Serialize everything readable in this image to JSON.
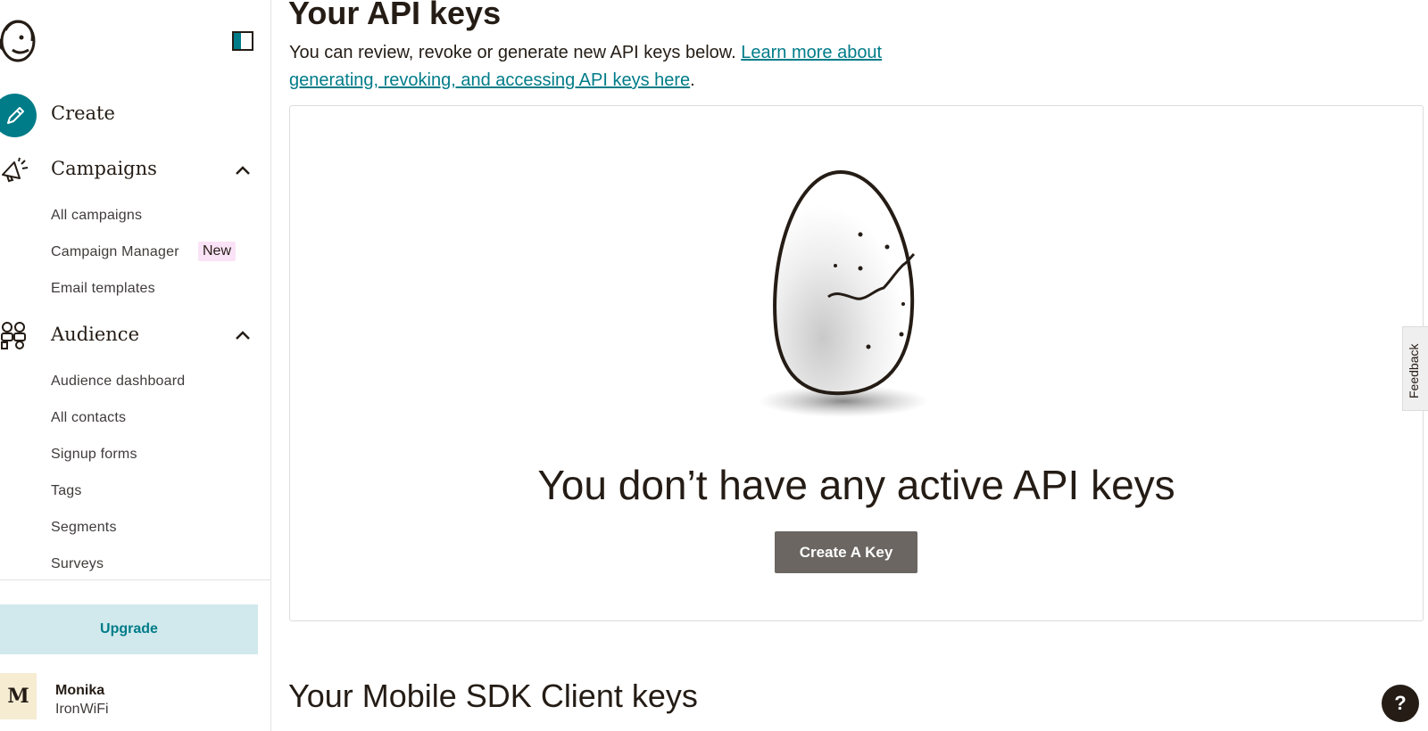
{
  "sidebar": {
    "create_label": "Create",
    "campaigns": {
      "label": "Campaigns",
      "items": [
        "All campaigns",
        "Campaign Manager",
        "Email templates"
      ],
      "new_badge": "New"
    },
    "audience": {
      "label": "Audience",
      "items": [
        "Audience dashboard",
        "All contacts",
        "Signup forms",
        "Tags",
        "Segments",
        "Surveys"
      ]
    },
    "upgrade_label": "Upgrade",
    "user": {
      "initial": "M",
      "name": "Monika",
      "org": "IronWiFi"
    }
  },
  "main": {
    "page_title": "Your API keys",
    "intro_text": "You can review, revoke or generate new API keys below. ",
    "intro_link": "Learn more about generating, revoking, and accessing API keys here",
    "intro_period": ".",
    "empty_state_heading": "You don’t have any active API keys",
    "create_key_label": "Create A Key",
    "mobile_section_title": "Your Mobile SDK Client keys"
  },
  "feedback_label": "Feedback",
  "help_label": "?",
  "colors": {
    "accent": "#007c89",
    "upgrade_bg": "#d1e9ec",
    "button_gray": "#6b6661",
    "new_badge_bg": "#fbe3f7"
  }
}
